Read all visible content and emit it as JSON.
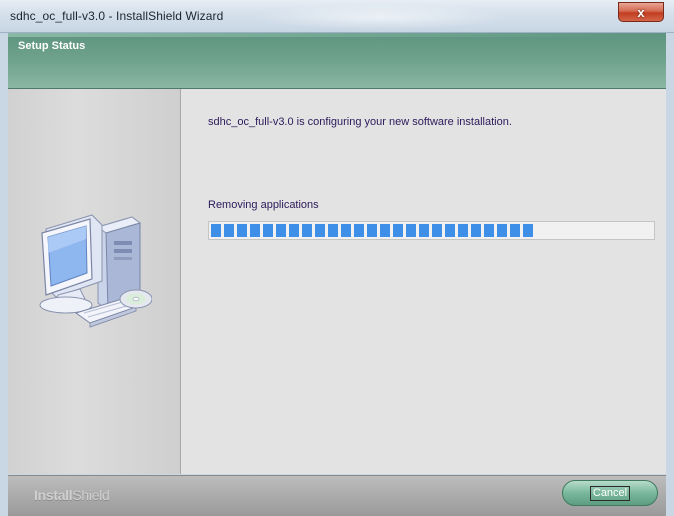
{
  "window": {
    "title": "sdhc_oc_full-v3.0 - InstallShield Wizard",
    "close_glyph": "x"
  },
  "header": {
    "title": "Setup Status"
  },
  "left_panel": {
    "illustration_icon": "computer-with-cd-icon"
  },
  "content": {
    "message": "sdhc_oc_full-v3.0 is configuring your new software installation.",
    "status_label": "Removing applications",
    "progress_percent": 73
  },
  "footer": {
    "brand_bold": "Install",
    "brand_light": "Shield",
    "cancel_label": "Cancel"
  },
  "colors": {
    "header_green": "#6fa28d",
    "progress_blue": "#3e8fe8",
    "text_purple": "#2c1a5a"
  }
}
